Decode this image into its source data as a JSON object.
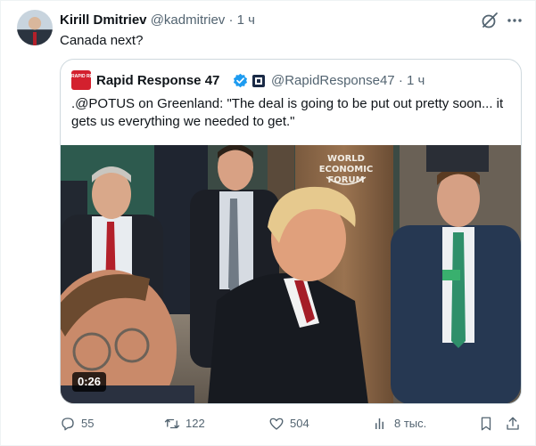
{
  "author": {
    "name": "Kirill Dmitriev",
    "handle": "@kadmitriev",
    "separator": "·",
    "time": "1 ч"
  },
  "tweet": {
    "text": "Canada next?"
  },
  "quoted": {
    "logo_text": "RAPID RESPONSE 47",
    "name": "Rapid Response 47",
    "handle": "@RapidResponse47",
    "separator": "·",
    "time": "1 ч",
    "text": ".@POTUS on Greenland: \"The deal is going to be put out pretty soon... it gets us everything we needed to get.\"",
    "media": {
      "duration": "0:26",
      "backdrop_text": [
        "WORLD",
        "ECONOMIC",
        "FORUM"
      ]
    }
  },
  "actions": {
    "replies": "55",
    "reposts": "122",
    "likes": "504",
    "views": "8 тыс."
  },
  "colors": {
    "text_primary": "#0f1419",
    "text_secondary": "#536471",
    "border": "#cfd9de",
    "verified_blue": "#1d9bf0",
    "logo_red": "#d3202e"
  },
  "icons": {
    "reply": "speech-bubble-icon",
    "repost": "repost-arrows-icon",
    "like": "heart-icon",
    "views": "bar-chart-icon",
    "bookmark": "bookmark-icon",
    "share": "share-upload-icon",
    "grok": "grok-slash-circle-icon",
    "more": "ellipsis-icon"
  }
}
